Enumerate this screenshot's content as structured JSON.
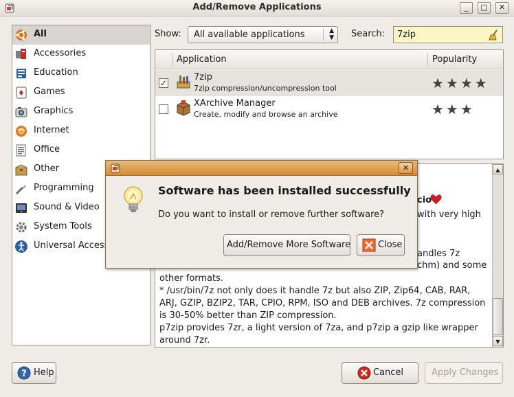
{
  "window": {
    "title": "Add/Remove Applications",
    "controls": [
      "_",
      "□",
      "✕"
    ]
  },
  "sidebar": {
    "items": [
      {
        "label": "All",
        "icon": "all-categories-icon",
        "selected": true
      },
      {
        "label": "Accessories",
        "icon": "accessories-icon"
      },
      {
        "label": "Education",
        "icon": "education-icon"
      },
      {
        "label": "Games",
        "icon": "games-icon"
      },
      {
        "label": "Graphics",
        "icon": "graphics-icon"
      },
      {
        "label": "Internet",
        "icon": "internet-icon"
      },
      {
        "label": "Office",
        "icon": "office-icon"
      },
      {
        "label": "Other",
        "icon": "other-icon"
      },
      {
        "label": "Programming",
        "icon": "programming-icon"
      },
      {
        "label": "Sound & Video",
        "icon": "sound-video-icon"
      },
      {
        "label": "System Tools",
        "icon": "system-tools-icon"
      },
      {
        "label": "Universal Access",
        "icon": "universal-access-icon"
      }
    ]
  },
  "filter": {
    "show_label": "Show:",
    "show_value": "All available applications",
    "search_label": "Search:",
    "search_value": "7zip"
  },
  "table": {
    "columns": [
      "Application",
      "Popularity"
    ],
    "rows": [
      {
        "checked": true,
        "check_mark": "✓",
        "name": "7zip",
        "description": "7zip compression/uncompression tool",
        "stars": "★★★★",
        "rating": 4,
        "icon": "archive-tools-icon"
      },
      {
        "checked": false,
        "check_mark": "",
        "name": "XArchive Manager",
        "description": "Create, modify and browse an archive",
        "stars": "★★★",
        "rating": 3,
        "icon": "archive-box-icon"
      }
    ]
  },
  "description": {
    "fragments": [
      "cio",
      "with very high",
      "andles 7z",
      "chm) and some"
    ],
    "paragraphs": [
      "other formats.",
      "* /usr/bin/7z not only does it handle 7z but also ZIP, Zip64, CAB, RAR, ARJ, GZIP, BZIP2, TAR, CPIO, RPM, ISO and DEB archives. 7z compression is 30-50% better than ZIP compression.",
      "p7zip provides 7zr, a light version of 7za, and p7zip a gzip like wrapper around 7zr."
    ]
  },
  "dialog": {
    "heading": "Software has been installed successfully",
    "message": "Do you want to install or remove further software?",
    "more_button": "Add/Remove More Software",
    "close_button": "Close",
    "close_glyph": "✕"
  },
  "footer": {
    "help_button": "Help",
    "cancel_button": "Cancel",
    "apply_button": "Apply Changes"
  },
  "glyphs": {
    "combo_up": "▲",
    "combo_down": "▼",
    "scroll_up": "▲",
    "scroll_down": "▼"
  },
  "colors": {
    "dialog_title": "#d68a33",
    "search_bg": "#fbf6c4",
    "heart": "#d11d1d"
  }
}
